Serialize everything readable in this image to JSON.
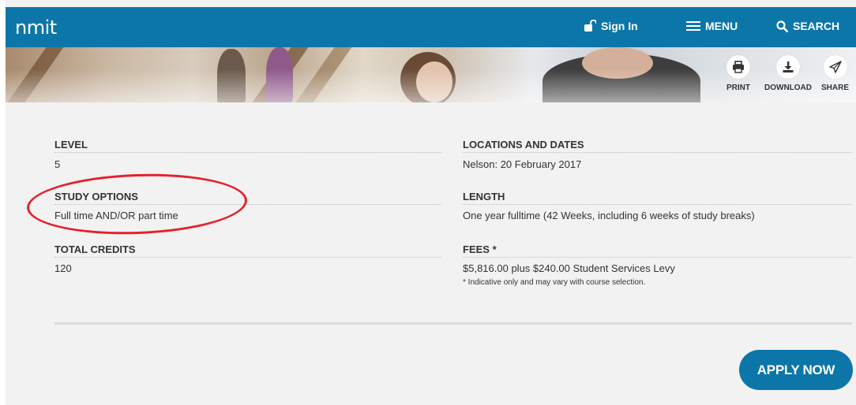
{
  "header": {
    "logo": "nmit",
    "sign_in": "Sign In",
    "menu": "MENU",
    "search": "SEARCH"
  },
  "tools": {
    "print": "PRINT",
    "download": "DOWNLOAD",
    "share": "SHARE"
  },
  "details": {
    "level": {
      "label": "LEVEL",
      "value": "5"
    },
    "study_options": {
      "label": "STUDY OPTIONS",
      "value": "Full time AND/OR part time"
    },
    "total_credits": {
      "label": "TOTAL CREDITS",
      "value": "120"
    },
    "locations": {
      "label": "LOCATIONS AND DATES",
      "value": "Nelson: 20 February 2017"
    },
    "length": {
      "label": "LENGTH",
      "value": "One year fulltime (42 Weeks, including 6 weeks of study breaks)"
    },
    "fees": {
      "label": "FEES *",
      "value": "$5,816.00 plus $240.00 Student Services Levy",
      "note": "* Indicative only and may vary with course selection."
    }
  },
  "actions": {
    "apply": "APPLY NOW"
  },
  "colors": {
    "brand_blue": "#0d76a8",
    "annotation_red": "#e3222b"
  },
  "icons": [
    "lock-open-icon",
    "hamburger-menu-icon",
    "search-icon",
    "printer-icon",
    "download-icon",
    "paper-plane-icon"
  ]
}
